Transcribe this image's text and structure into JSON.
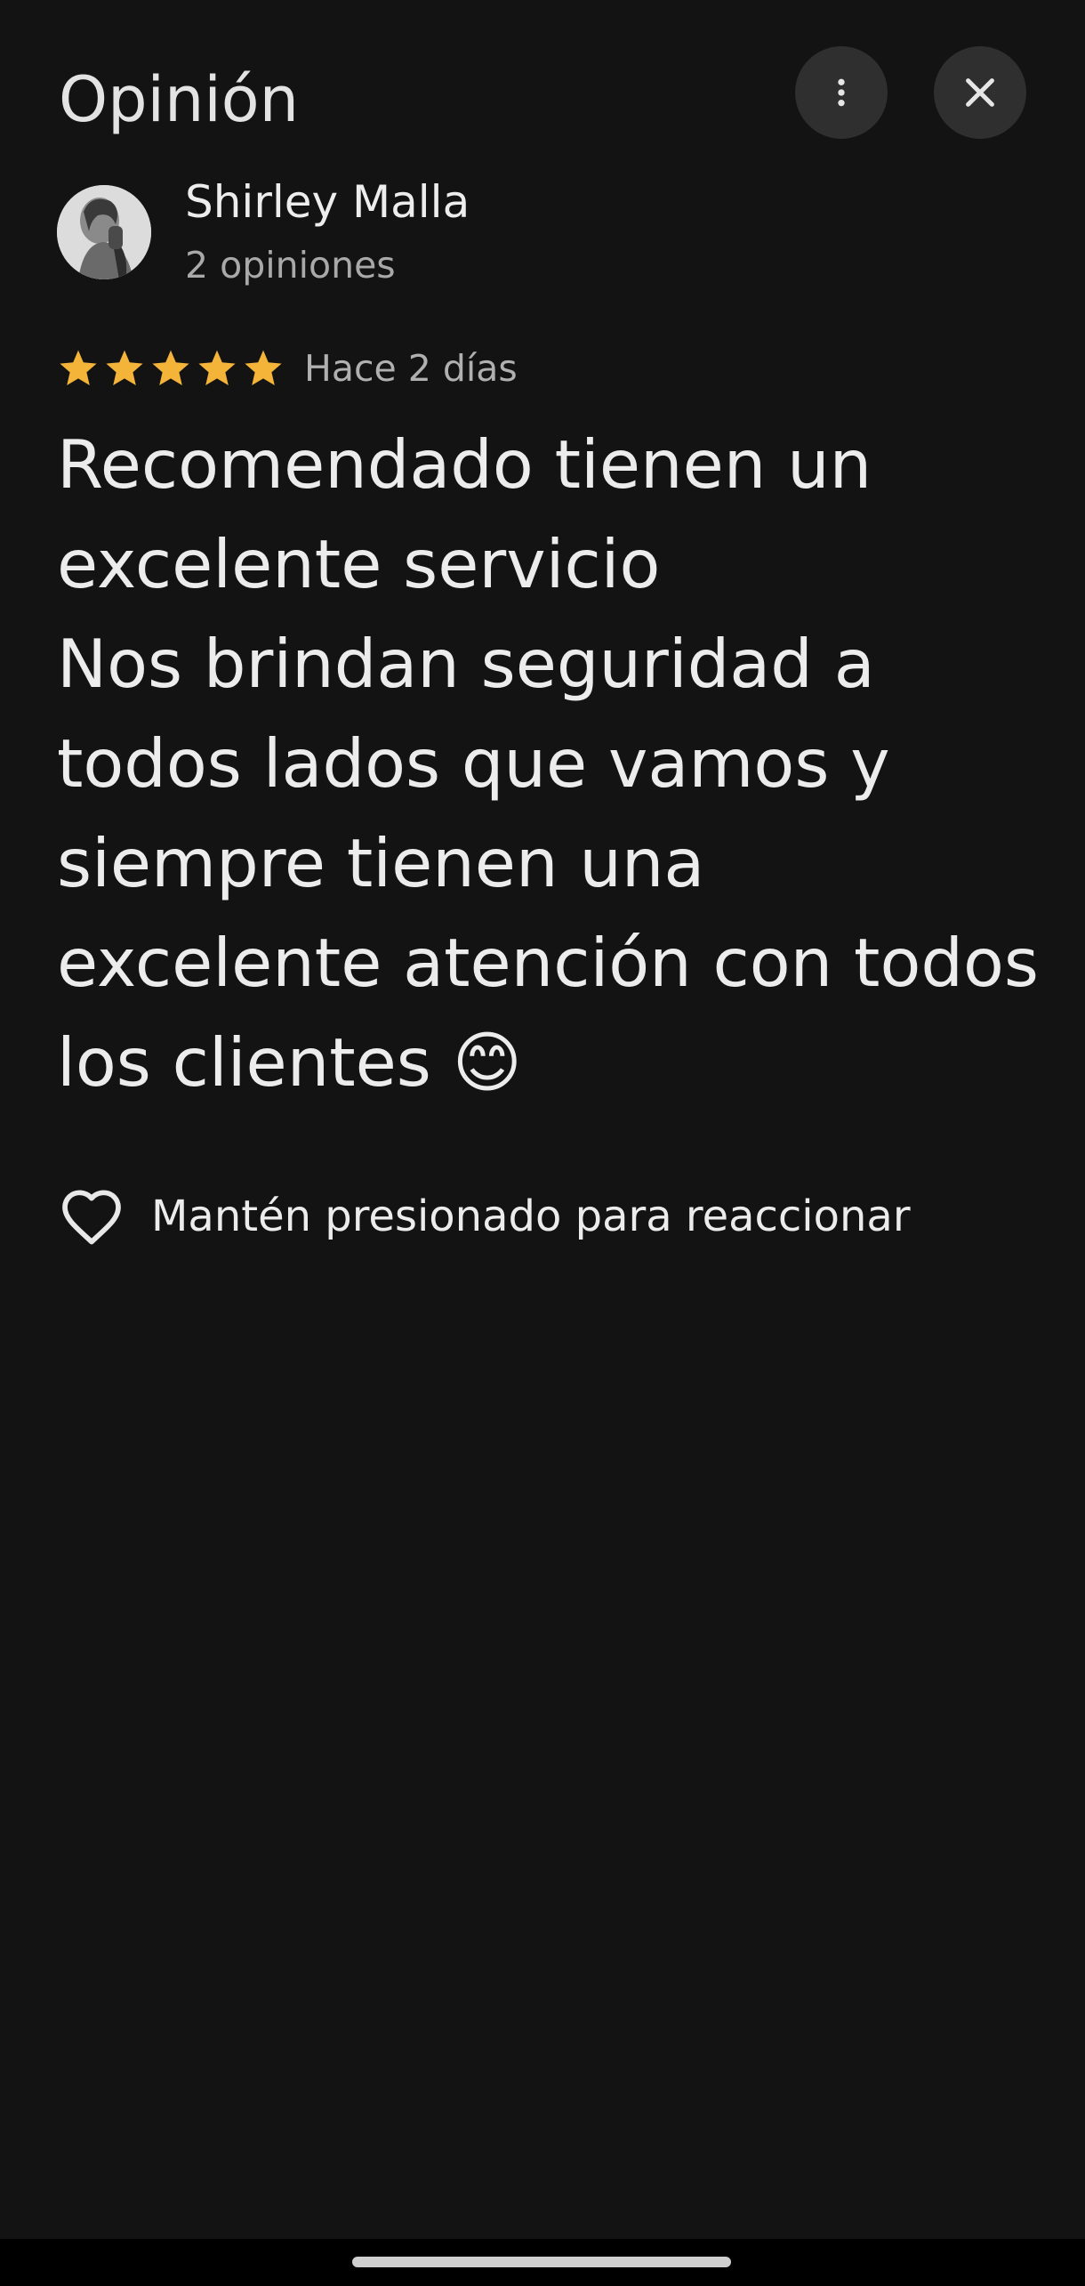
{
  "header": {
    "title": "Opinión",
    "more_icon": "more-vert-icon",
    "close_icon": "close-icon"
  },
  "review": {
    "author_name": "Shirley Malla",
    "author_reviews": "2 opiniones",
    "rating": 5,
    "rating_max": 5,
    "star_color": "#f4b43a",
    "date": "Hace 2 días",
    "text": "Recomendado tienen un excelente servicio\nNos brindan seguridad a todos lados que vamos y siempre tienen una excelente atención con todos los clientes 😊"
  },
  "reaction": {
    "icon": "heart-outline-icon",
    "label": "Mantén presionado para reaccionar"
  }
}
